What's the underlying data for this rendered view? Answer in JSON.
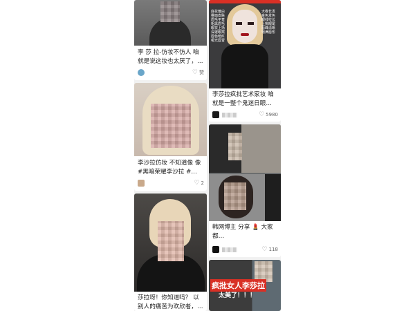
{
  "feed": {
    "left_cards": [
      {
        "title": "李 莎 拉-仿妆不仿人 咱就是说这妆也太厌了，…",
        "likes": "赞"
      },
      {
        "title": "李沙拉仿妆 不知道像 像 #黑暗荣耀李沙拉 #…",
        "likes": "2"
      },
      {
        "title": "莎拉呀！你知道吗？ 以别人的痛苦为欢欣者，…",
        "likes": ""
      }
    ],
    "right_cards": [
      {
        "title": "李莎拉疯批艺术家妆 咱就是一整个鬼迷日眼…",
        "likes": "5980",
        "overlay_left": "底妆偏白\n雾面皮肤\n眉毛平直\n粗黑眉毛\n眼妆上扬\n深邃眼窝\n唇色暗红\n哑光唇膏",
        "overlay_right": "大卷长发\n金色发色\n眼线拉长\n上挑眼尾\n唇峰清晰\n饱满唇形"
      },
      {
        "title": "韩网博主 分享 💄 大家都…",
        "likes": "118"
      },
      {
        "banner_line1": "疯批女人李莎拉",
        "banner_line2": "太美了！！！"
      }
    ]
  },
  "colors": {
    "background": "#f1f1f1",
    "card": "#ffffff",
    "title_text": "#222222",
    "banner_red": "#d93025"
  },
  "icons": {
    "like": "heart-outline-icon"
  }
}
